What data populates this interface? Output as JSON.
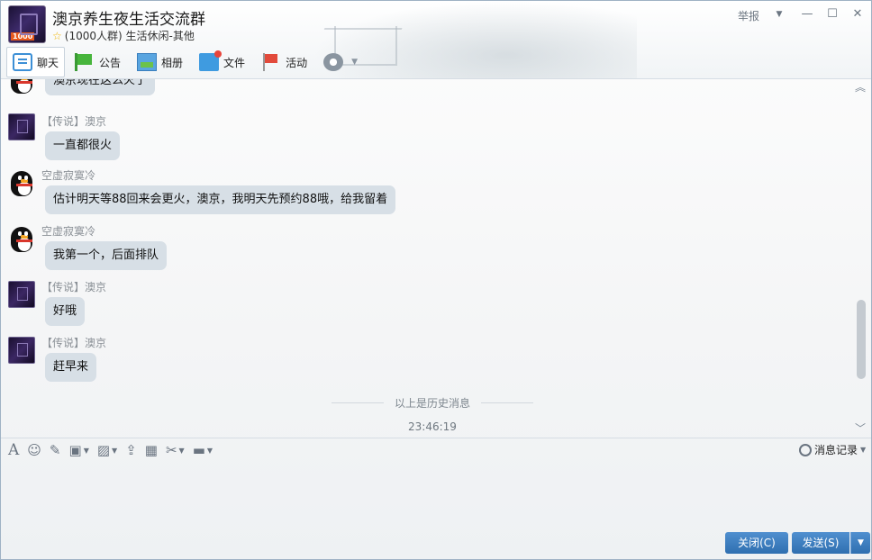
{
  "header": {
    "group_name": "澳京养生夜生活交流群",
    "member_info": "(1000人群)",
    "category": "生活休闲-其他",
    "avatar_badge": "1000",
    "report_label": "举报",
    "star_glyph": "☆"
  },
  "window_controls": {
    "dropdown": "▼",
    "minimize": "—",
    "maximize": "☐",
    "close": "✕"
  },
  "tabs": [
    {
      "label": "聊天",
      "icon": "chat-icon"
    },
    {
      "label": "公告",
      "icon": "notice-icon"
    },
    {
      "label": "相册",
      "icon": "album-icon"
    },
    {
      "label": "文件",
      "icon": "file-icon"
    },
    {
      "label": "活动",
      "icon": "activity-icon"
    }
  ],
  "settings": {
    "icon": "gear-icon",
    "caret": "▼"
  },
  "messages": [
    {
      "sender": "",
      "text": "澳京现在这么火了",
      "avatar": "penguin"
    },
    {
      "sender": "【传说】澳京",
      "text": "一直都很火",
      "avatar": "legend"
    },
    {
      "sender": "空虚寂寞冷",
      "text": "估计明天等88回来会更火，澳京，我明天先预约88哦，给我留着",
      "avatar": "penguin"
    },
    {
      "sender": "空虚寂寞冷",
      "text": "我第一个，后面排队",
      "avatar": "penguin"
    },
    {
      "sender": "【传说】澳京",
      "text": "好哦",
      "avatar": "legend"
    },
    {
      "sender": "【传说】澳京",
      "text": "赶早来",
      "avatar": "legend"
    }
  ],
  "history_separator": "以上是历史消息",
  "timestamp": "23:46:19",
  "toolbar": {
    "tools": [
      "font-icon",
      "emoji-icon",
      "magic-wand-icon",
      "gif-icon",
      "image-icon",
      "upload-icon",
      "gift-icon",
      "scissors-icon",
      "screen-share-icon"
    ],
    "history_label": "消息记录"
  },
  "buttons": {
    "close_label": "关闭(C)",
    "send_label": "发送(S)",
    "send_arrow": "▼"
  }
}
